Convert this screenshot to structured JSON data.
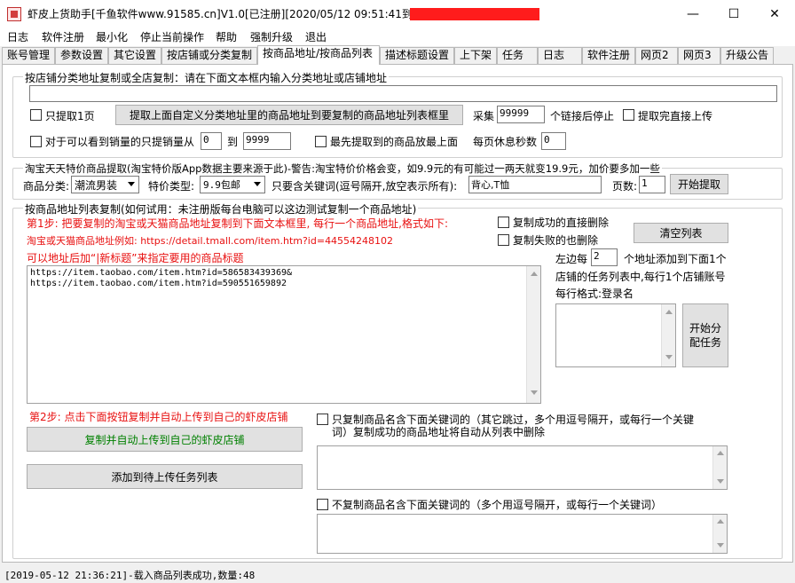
{
  "window": {
    "title": "虾皮上货助手[千鱼软件www.91585.cn]V1.0[已注册][2020/05/12 09:51:41到期]",
    "minimize": "—",
    "maximize": "☐",
    "close": "✕"
  },
  "menu": [
    "日志",
    "软件注册",
    "最小化",
    "停止当前操作",
    "帮助",
    "强制升级",
    "退出"
  ],
  "tabs": [
    "账号管理",
    "参数设置",
    "其它设置",
    "按店铺或分类复制",
    "按商品地址/按商品列表",
    "描述标题设置",
    "上下架",
    "任务",
    "日志",
    "软件注册",
    "网页2",
    "网页3",
    "升级公告"
  ],
  "group1": {
    "legend": "按店铺分类地址复制或全店复制：请在下面文本框内输入分类地址或店铺地址",
    "url_value": "",
    "only_page1": "只提取1页",
    "extract_button": "提取上面自定义分类地址里的商品地址到要复制的商品地址列表框里",
    "collect_label": "采集",
    "collect_value": "99999",
    "stop_label": "个链接后停止",
    "direct_upload": "提取完直接上传",
    "sales_label": "对于可以看到销量的只提销量从",
    "sales_from": "0",
    "sales_to_label": "到",
    "sales_to": "9999",
    "first_last": "最先提取到的商品放最上面",
    "rest_label": "每页休息秒数",
    "rest_value": "0"
  },
  "group2": {
    "legend": "淘宝天天特价商品提取(淘宝特价版App数据主要来源于此)-警告:淘宝特价价格会变，如9.9元的有可能过一两天就变19.9元，加价要多加一些",
    "category_label": "商品分类:",
    "category_value": "潮流男装",
    "price_type_label": "特价类型:",
    "price_type_value": "9.9包邮",
    "keyword_label": "只要含关键词(逗号隔开,放空表示所有):",
    "keyword_value": "背心,T恤",
    "pages_label": "页数:",
    "pages_value": "1",
    "start_button": "开始提取"
  },
  "group3": {
    "legend": "按商品地址列表复制(如何试用：未注册版每台电脑可以这边测试复制一个商品地址)",
    "step1": "第1步: 把要复制的淘宝或天猫商品地址复制到下面文本框里, 每行一个商品地址,格式如下:",
    "example": "淘宝或天猫商品地址例如: https://detail.tmall.com/item.htm?id=44554248102",
    "title_hint": "可以地址后加“|新标题”来指定要用的商品标题",
    "delete_success": "复制成功的直接删除",
    "delete_fail": "复制失败的也删除",
    "clear_button": "清空列表",
    "urls": [
      "https://item.taobao.com/item.htm?id=586583439369&",
      "https://item.taobao.com/item.htm?id=590551659892"
    ],
    "left_each": "左边每",
    "each_value": "2",
    "assign_text1": "个地址添加到下面1个",
    "assign_text2": "店铺的任务列表中,每行1个店铺账号",
    "assign_text3": "每行格式:登录名",
    "assign_button_line1": "开始分",
    "assign_button_line2": "配任务",
    "step2": "第2步: 点击下面按钮复制并自动上传到自己的虾皮店铺",
    "copy_upload_button": "复制并自动上传到自己的虾皮店铺",
    "add_task_button": "添加到待上传任务列表",
    "include_kw_line1": "只复制商品名含下面关键词的（其它跳过，多个用逗号隔开，或每行一个关键",
    "include_kw_line2": "词）复制成功的商品地址将自动从列表中删除",
    "exclude_kw": "不复制商品名含下面关键词的（多个用逗号隔开，或每行一个关键词）"
  },
  "status": "[2019-05-12 21:36:21]-载入商品列表成功,数量:48"
}
